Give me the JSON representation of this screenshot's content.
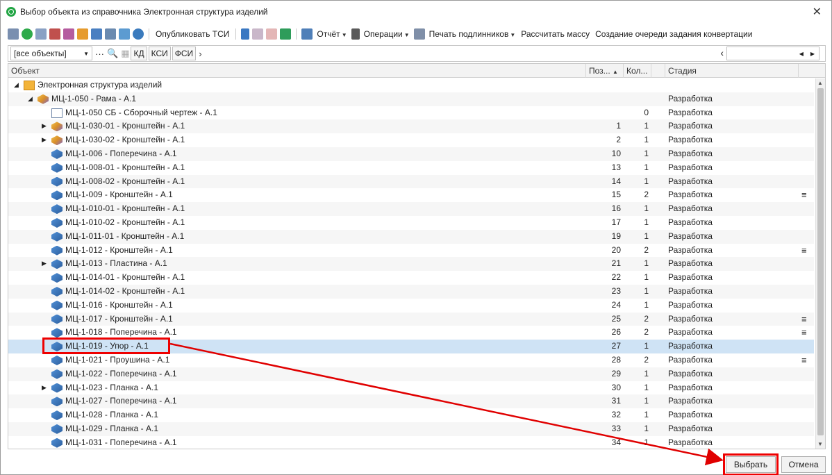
{
  "window": {
    "title": "Выбор объекта из справочника Электронная структура изделий",
    "close_glyph": "✕"
  },
  "toolbar": {
    "publish_tsi": "Опубликовать ТСИ",
    "report": "Отчёт",
    "operations": "Операции",
    "print_originals": "Печать подлинников",
    "calc_mass": "Рассчитать массу",
    "create_queue": "Создание очереди задания конвертации"
  },
  "filter": {
    "combo_value": "[все объекты]",
    "btn_kd": "КД",
    "btn_ksi": "КСИ",
    "btn_fsi": "ФСИ"
  },
  "grid": {
    "columns": {
      "object": "Объект",
      "position": "Поз...",
      "quantity": "Кол...",
      "stage": "Стадия"
    },
    "rows": [
      {
        "level": 0,
        "expander": "◢",
        "icon": "root",
        "label": "Электронная структура изделий",
        "pos": "",
        "qty": "",
        "stage": "",
        "menu": ""
      },
      {
        "level": 1,
        "expander": "◢",
        "icon": "asm",
        "label": "МЦ-1-050 - Рама - А.1",
        "pos": "",
        "qty": "",
        "stage": "Разработка",
        "menu": ""
      },
      {
        "level": 2,
        "expander": "",
        "icon": "doc",
        "label": "МЦ-1-050 СБ - Сборочный чертеж - А.1",
        "pos": "",
        "qty": "0",
        "stage": "Разработка",
        "menu": ""
      },
      {
        "level": 2,
        "expander": "▶",
        "icon": "asm",
        "label": "МЦ-1-030-01 - Кронштейн - А.1",
        "pos": "1",
        "qty": "1",
        "stage": "Разработка",
        "menu": ""
      },
      {
        "level": 2,
        "expander": "▶",
        "icon": "asm",
        "label": "МЦ-1-030-02 - Кронштейн - А.1",
        "pos": "2",
        "qty": "1",
        "stage": "Разработка",
        "menu": ""
      },
      {
        "level": 2,
        "expander": "",
        "icon": "part",
        "label": "МЦ-1-006 - Поперечина - А.1",
        "pos": "10",
        "qty": "1",
        "stage": "Разработка",
        "menu": ""
      },
      {
        "level": 2,
        "expander": "",
        "icon": "part",
        "label": "МЦ-1-008-01 - Кронштейн - А.1",
        "pos": "13",
        "qty": "1",
        "stage": "Разработка",
        "menu": ""
      },
      {
        "level": 2,
        "expander": "",
        "icon": "part",
        "label": "МЦ-1-008-02 - Кронштейн - А.1",
        "pos": "14",
        "qty": "1",
        "stage": "Разработка",
        "menu": ""
      },
      {
        "level": 2,
        "expander": "",
        "icon": "part",
        "label": "МЦ-1-009 - Кронштейн - А.1",
        "pos": "15",
        "qty": "2",
        "stage": "Разработка",
        "menu": "≡"
      },
      {
        "level": 2,
        "expander": "",
        "icon": "part",
        "label": "МЦ-1-010-01 - Кронштейн - А.1",
        "pos": "16",
        "qty": "1",
        "stage": "Разработка",
        "menu": ""
      },
      {
        "level": 2,
        "expander": "",
        "icon": "part",
        "label": "МЦ-1-010-02 - Кронштейн - А.1",
        "pos": "17",
        "qty": "1",
        "stage": "Разработка",
        "menu": ""
      },
      {
        "level": 2,
        "expander": "",
        "icon": "part",
        "label": "МЦ-1-011-01 - Кронштейн - А.1",
        "pos": "19",
        "qty": "1",
        "stage": "Разработка",
        "menu": ""
      },
      {
        "level": 2,
        "expander": "",
        "icon": "part",
        "label": "МЦ-1-012 - Кронштейн - А.1",
        "pos": "20",
        "qty": "2",
        "stage": "Разработка",
        "menu": "≡"
      },
      {
        "level": 2,
        "expander": "▶",
        "icon": "part",
        "label": "МЦ-1-013 - Пластина - А.1",
        "pos": "21",
        "qty": "1",
        "stage": "Разработка",
        "menu": ""
      },
      {
        "level": 2,
        "expander": "",
        "icon": "part",
        "label": "МЦ-1-014-01 - Кронштейн - А.1",
        "pos": "22",
        "qty": "1",
        "stage": "Разработка",
        "menu": ""
      },
      {
        "level": 2,
        "expander": "",
        "icon": "part",
        "label": "МЦ-1-014-02 - Кронштейн - А.1",
        "pos": "23",
        "qty": "1",
        "stage": "Разработка",
        "menu": ""
      },
      {
        "level": 2,
        "expander": "",
        "icon": "part",
        "label": "МЦ-1-016 - Кронштейн - А.1",
        "pos": "24",
        "qty": "1",
        "stage": "Разработка",
        "menu": ""
      },
      {
        "level": 2,
        "expander": "",
        "icon": "part",
        "label": "МЦ-1-017 - Кронштейн - А.1",
        "pos": "25",
        "qty": "2",
        "stage": "Разработка",
        "menu": "≡"
      },
      {
        "level": 2,
        "expander": "",
        "icon": "part",
        "label": "МЦ-1-018 - Поперечина - А.1",
        "pos": "26",
        "qty": "2",
        "stage": "Разработка",
        "menu": "≡"
      },
      {
        "level": 2,
        "expander": "",
        "icon": "part",
        "label": "МЦ-1-019 - Упор - А.1",
        "pos": "27",
        "qty": "1",
        "stage": "Разработка",
        "menu": "",
        "selected": true
      },
      {
        "level": 2,
        "expander": "",
        "icon": "part",
        "label": "МЦ-1-021 - Проушина - А.1",
        "pos": "28",
        "qty": "2",
        "stage": "Разработка",
        "menu": "≡"
      },
      {
        "level": 2,
        "expander": "",
        "icon": "part",
        "label": "МЦ-1-022 - Поперечина - А.1",
        "pos": "29",
        "qty": "1",
        "stage": "Разработка",
        "menu": ""
      },
      {
        "level": 2,
        "expander": "▶",
        "icon": "part",
        "label": "МЦ-1-023 - Планка - А.1",
        "pos": "30",
        "qty": "1",
        "stage": "Разработка",
        "menu": ""
      },
      {
        "level": 2,
        "expander": "",
        "icon": "part",
        "label": "МЦ-1-027 - Поперечина - А.1",
        "pos": "31",
        "qty": "1",
        "stage": "Разработка",
        "menu": ""
      },
      {
        "level": 2,
        "expander": "",
        "icon": "part",
        "label": "МЦ-1-028 - Планка - А.1",
        "pos": "32",
        "qty": "1",
        "stage": "Разработка",
        "menu": ""
      },
      {
        "level": 2,
        "expander": "",
        "icon": "part",
        "label": "МЦ-1-029 - Планка - А.1",
        "pos": "33",
        "qty": "1",
        "stage": "Разработка",
        "menu": ""
      },
      {
        "level": 2,
        "expander": "",
        "icon": "part",
        "label": "МЦ-1-031 - Поперечина - А.1",
        "pos": "34",
        "qty": "1",
        "stage": "Разработка",
        "menu": ""
      }
    ]
  },
  "footer": {
    "select_button": "Выбрать",
    "cancel_button": "Отмена"
  },
  "colors": {
    "accent_highlight": "#e00000",
    "selection": "#cfe3f5"
  }
}
